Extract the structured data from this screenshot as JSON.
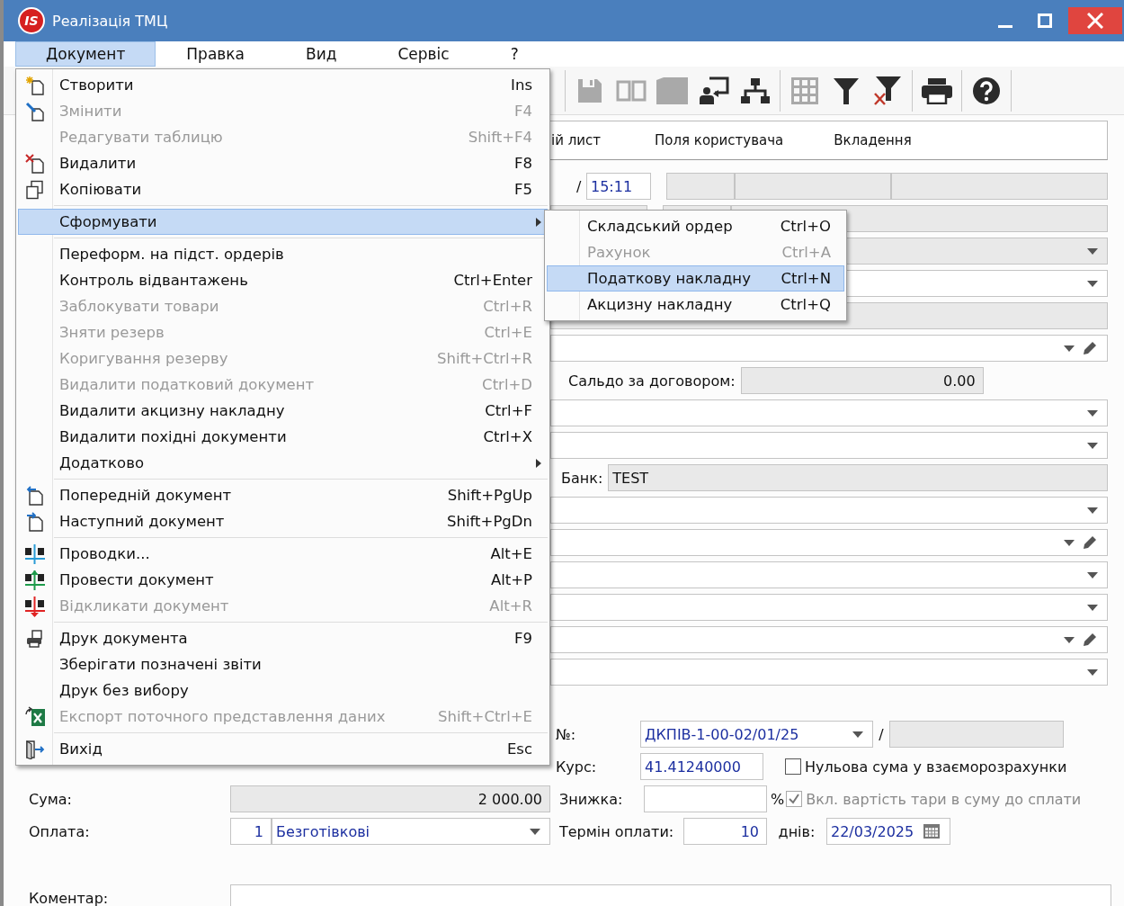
{
  "window": {
    "title": "Реалізація ТМЦ",
    "logo_text": "IS"
  },
  "menubar": [
    {
      "label": "Документ",
      "selected": true
    },
    {
      "label": "Правка",
      "selected": false
    },
    {
      "label": "Вид",
      "selected": false
    },
    {
      "label": "Сервіс",
      "selected": false
    },
    {
      "label": "?",
      "selected": false
    }
  ],
  "toolbar": [
    {
      "kind": "separator"
    },
    {
      "kind": "button",
      "disabled": true
    },
    {
      "kind": "button",
      "disabled": true
    },
    {
      "kind": "button",
      "disabled": true
    },
    {
      "kind": "button",
      "disabled": false
    },
    {
      "kind": "button",
      "disabled": false
    },
    {
      "kind": "separator"
    },
    {
      "kind": "button",
      "disabled": true
    },
    {
      "kind": "button",
      "disabled": false
    },
    {
      "kind": "button",
      "disabled": false
    },
    {
      "kind": "separator"
    },
    {
      "kind": "button",
      "disabled": false
    },
    {
      "kind": "separator"
    },
    {
      "kind": "button",
      "disabled": false
    },
    {
      "kind": "separator"
    }
  ],
  "tabs": [
    {
      "label": "ій лист",
      "selected": false
    },
    {
      "label": "Поля користувача",
      "selected": false
    },
    {
      "label": "Вкладення",
      "selected": false
    }
  ],
  "form_rows": [
    {
      "kind": "time",
      "separator": "/",
      "value": "15:11"
    },
    {
      "kind": "readonly-split"
    },
    {
      "kind": "combo",
      "disabled": true
    },
    {
      "kind": "combo",
      "disabled": false
    },
    {
      "kind": "readonly"
    },
    {
      "kind": "combo-edit"
    },
    {
      "kind": "balance",
      "label": "Сальдо за договором:",
      "value": "0.00"
    },
    {
      "kind": "combo",
      "disabled": false
    },
    {
      "kind": "combo",
      "disabled": false
    },
    {
      "kind": "bank",
      "label": "Банк:",
      "value": "TEST"
    },
    {
      "kind": "combo",
      "disabled": false
    },
    {
      "kind": "combo-edit"
    },
    {
      "kind": "combo",
      "disabled": false
    },
    {
      "kind": "combo",
      "disabled": false
    },
    {
      "kind": "combo-edit"
    },
    {
      "kind": "combo",
      "disabled": false
    }
  ],
  "details": {
    "number": {
      "label": "№:",
      "value": "ДКПІВ-1-00-02/01/25",
      "separator": "/"
    },
    "rate": {
      "label": "Курс:",
      "value": "41.41240000"
    },
    "zero_sum": {
      "label": "Нульова сума у взаєморозрахунки",
      "checked": false,
      "disabled": false
    },
    "sum": {
      "label": "Сума:",
      "value": "2 000.00"
    },
    "discount": {
      "label": "Знижка:",
      "unit": "%"
    },
    "include_tare": {
      "label": "Вкл. вартість тари в суму до сплати",
      "checked": true,
      "disabled": true
    },
    "payment": {
      "label": "Оплата:",
      "code": "1",
      "value": "Безготівкові"
    },
    "term": {
      "label": "Термін оплати:",
      "value": "10",
      "unit": "днів:",
      "date": "22/03/2025"
    },
    "comment": {
      "label": "Коментар:"
    }
  },
  "menu": [
    {
      "kind": "item",
      "label": "Створити",
      "shortcut": "Ins",
      "disabled": false,
      "selected": false,
      "submenu": false
    },
    {
      "kind": "item",
      "label": "Змінити",
      "shortcut": "F4",
      "disabled": true,
      "selected": false,
      "submenu": false
    },
    {
      "kind": "item",
      "label": "Редагувати таблицю",
      "shortcut": "Shift+F4",
      "disabled": true,
      "selected": false,
      "submenu": false
    },
    {
      "kind": "item",
      "label": "Видалити",
      "shortcut": "F8",
      "disabled": false,
      "selected": false,
      "submenu": false
    },
    {
      "kind": "item",
      "label": "Копіювати",
      "shortcut": "F5",
      "disabled": false,
      "selected": false,
      "submenu": false
    },
    {
      "kind": "separator"
    },
    {
      "kind": "item",
      "label": "Сформувати",
      "disabled": false,
      "selected": true,
      "submenu": true
    },
    {
      "kind": "separator"
    },
    {
      "kind": "item",
      "label": "Переформ. на підст. ордерів",
      "disabled": false,
      "selected": false,
      "submenu": false
    },
    {
      "kind": "item",
      "label": "Контроль відвантажень",
      "shortcut": "Ctrl+Enter",
      "disabled": false,
      "selected": false,
      "submenu": false
    },
    {
      "kind": "item",
      "label": "Заблокувати товари",
      "shortcut": "Ctrl+R",
      "disabled": true,
      "selected": false,
      "submenu": false
    },
    {
      "kind": "item",
      "label": "Зняти резерв",
      "shortcut": "Ctrl+E",
      "disabled": true,
      "selected": false,
      "submenu": false
    },
    {
      "kind": "item",
      "label": "Коригування резерву",
      "shortcut": "Shift+Ctrl+R",
      "disabled": true,
      "selected": false,
      "submenu": false
    },
    {
      "kind": "item",
      "label": "Видалити податковий документ",
      "shortcut": "Ctrl+D",
      "disabled": true,
      "selected": false,
      "submenu": false
    },
    {
      "kind": "item",
      "label": "Видалити акцизну накладну",
      "shortcut": "Ctrl+F",
      "disabled": false,
      "selected": false,
      "submenu": false
    },
    {
      "kind": "item",
      "label": "Видалити похідні документи",
      "shortcut": "Ctrl+X",
      "disabled": false,
      "selected": false,
      "submenu": false
    },
    {
      "kind": "item",
      "label": "Додатково",
      "disabled": false,
      "selected": false,
      "submenu": true
    },
    {
      "kind": "separator"
    },
    {
      "kind": "item",
      "label": "Попередній документ",
      "shortcut": "Shift+PgUp",
      "disabled": false,
      "selected": false,
      "submenu": false
    },
    {
      "kind": "item",
      "label": "Наступний документ",
      "shortcut": "Shift+PgDn",
      "disabled": false,
      "selected": false,
      "submenu": false
    },
    {
      "kind": "separator"
    },
    {
      "kind": "item",
      "label": "Проводки...",
      "shortcut": "Alt+E",
      "disabled": false,
      "selected": false,
      "submenu": false
    },
    {
      "kind": "item",
      "label": "Провести документ",
      "shortcut": "Alt+P",
      "disabled": false,
      "selected": false,
      "submenu": false
    },
    {
      "kind": "item",
      "label": "Відкликати документ",
      "shortcut": "Alt+R",
      "disabled": true,
      "selected": false,
      "submenu": false
    },
    {
      "kind": "separator"
    },
    {
      "kind": "item",
      "label": "Друк документа",
      "shortcut": "F9",
      "disabled": false,
      "selected": false,
      "submenu": false
    },
    {
      "kind": "item",
      "label": "Зберігати позначені звіти",
      "disabled": false,
      "selected": false,
      "submenu": false
    },
    {
      "kind": "item",
      "label": "Друк без вибору",
      "disabled": false,
      "selected": false,
      "submenu": false
    },
    {
      "kind": "item",
      "label": "Експорт поточного представлення даних",
      "shortcut": "Shift+Ctrl+E",
      "disabled": true,
      "selected": false,
      "submenu": false
    },
    {
      "kind": "separator"
    },
    {
      "kind": "item",
      "label": "Вихід",
      "shortcut": "Esc",
      "disabled": false,
      "selected": false,
      "submenu": false
    }
  ],
  "submenu": [
    {
      "label": "Складський ордер",
      "shortcut": "Ctrl+O",
      "disabled": false,
      "selected": false
    },
    {
      "label": "Рахунок",
      "shortcut": "Ctrl+A",
      "disabled": true,
      "selected": false
    },
    {
      "label": "Податкову накладну",
      "shortcut": "Ctrl+N",
      "disabled": false,
      "selected": true
    },
    {
      "label": "Акцизну накладну",
      "shortcut": "Ctrl+Q",
      "disabled": false,
      "selected": false
    }
  ]
}
